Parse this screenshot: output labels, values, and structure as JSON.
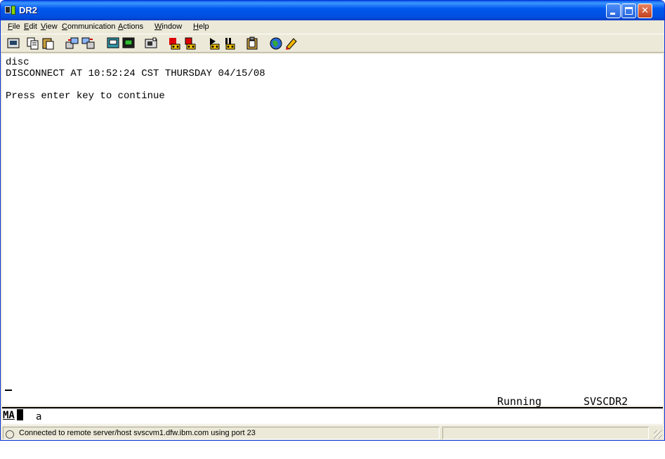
{
  "window": {
    "title": "DR2",
    "buttons": {
      "minimize": "minimize-icon",
      "maximize": "maximize-icon",
      "close": "close-icon"
    }
  },
  "menu": {
    "items": [
      {
        "label": "File",
        "mnemonic": "F"
      },
      {
        "label": "Edit",
        "mnemonic": "E"
      },
      {
        "label": "View",
        "mnemonic": "V"
      },
      {
        "label": "Communication",
        "mnemonic": "C"
      },
      {
        "label": "Actions",
        "mnemonic": "A"
      },
      {
        "label": "Window",
        "mnemonic": "W"
      },
      {
        "label": "Help",
        "mnemonic": "H"
      }
    ]
  },
  "toolbar": {
    "icons": [
      "print-screen-icon",
      "copy-icon",
      "paste-icon",
      "send-file-icon",
      "receive-file-icon",
      "display-setup-icon",
      "keyboard-map-icon",
      "macro-icon",
      "record-macro-icon",
      "stop-macro-icon",
      "play-macro-icon",
      "pause-macro-icon",
      "clipboard-icon",
      "web-help-icon",
      "edit-pen-icon"
    ]
  },
  "screen": {
    "lines": [
      "disc",
      "DISCONNECT AT 10:52:24 CST THURSDAY 04/15/08",
      "",
      "Press enter key to continue"
    ],
    "status_left": "Running",
    "status_right": "SVSCDR2"
  },
  "oia": {
    "indicator": "MA",
    "field": "a"
  },
  "statusbar": {
    "message": "Connected to remote server/host svscvm1.dfw.ibm.com using port 23"
  }
}
